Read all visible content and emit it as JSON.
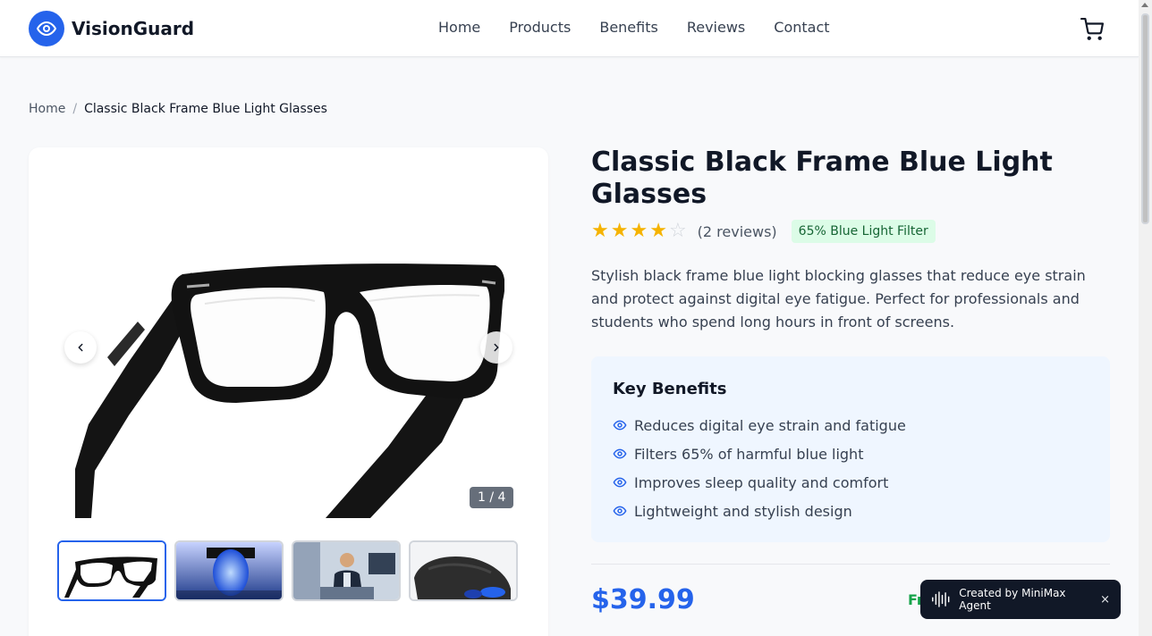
{
  "header": {
    "brand": "VisionGuard",
    "nav": [
      "Home",
      "Products",
      "Benefits",
      "Reviews",
      "Contact"
    ]
  },
  "breadcrumb": {
    "home": "Home",
    "separator": "/",
    "current": "Classic Black Frame Blue Light Glasses"
  },
  "gallery": {
    "counter": "1 / 4",
    "current_index": 1,
    "total": 4
  },
  "product": {
    "title": "Classic Black Frame Blue Light Glasses",
    "rating": 4,
    "rating_max": 5,
    "reviews": "(2 reviews)",
    "badge": "65% Blue Light Filter",
    "description": "Stylish black frame blue light blocking glasses that reduce eye strain and protect against digital eye fatigue. Perfect for professionals and students who spend long hours in front of screens.",
    "benefits_title": "Key Benefits",
    "benefits": [
      "Reduces digital eye strain and fatigue",
      "Filters 65% of harmful blue light",
      "Improves sleep quality and comfort",
      "Lightweight and stylish design"
    ],
    "price": "$39.99",
    "shipping_partial": "Fr"
  },
  "toast": {
    "label": "Created by MiniMax Agent",
    "close": "×"
  },
  "colors": {
    "accent": "#2563eb",
    "star": "#f5b301",
    "badge_bg": "#dcfce7",
    "badge_text": "#166534",
    "benefits_bg": "#eff6ff",
    "shipping_green": "#16a34a"
  },
  "icons": [
    "eye-icon",
    "cart-icon",
    "chevron-left-icon",
    "chevron-right-icon",
    "star-icon",
    "waveform-icon",
    "close-icon"
  ]
}
